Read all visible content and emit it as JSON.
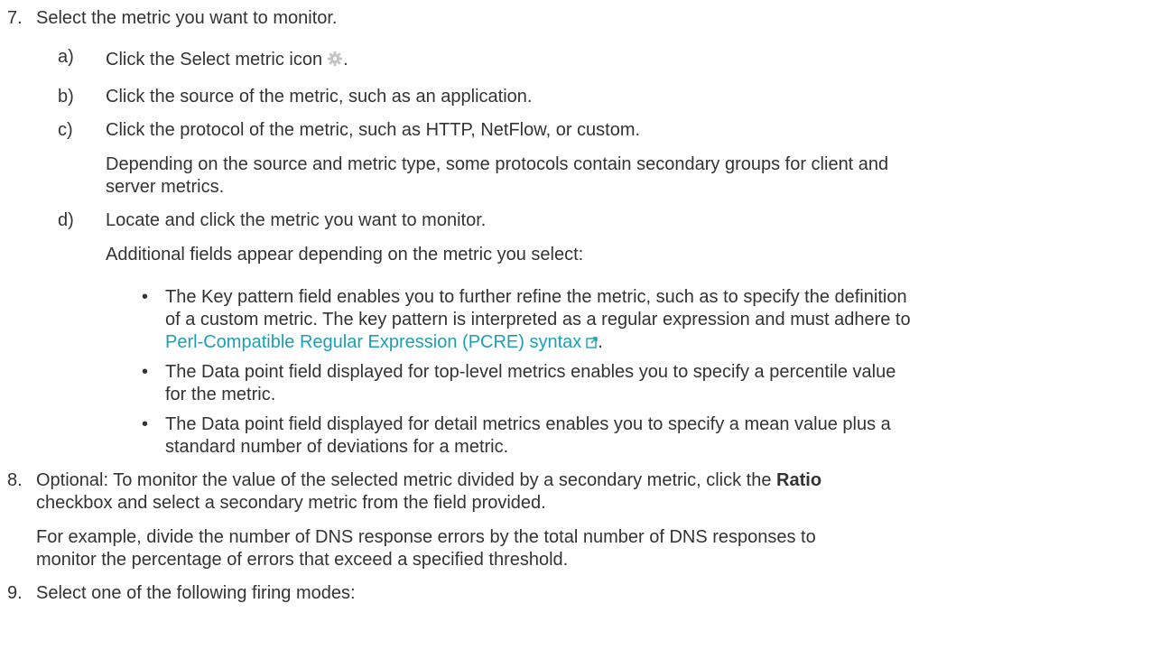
{
  "step7": {
    "number": "7.",
    "text": "Select the metric you want to monitor.",
    "a": {
      "letter": "a)",
      "text": "Click the Select metric icon",
      "icon": "gear-icon",
      "tail": "."
    },
    "b": {
      "letter": "b)",
      "text": "Click the source of the metric, such as an application."
    },
    "c": {
      "letter": "c)",
      "text": "Click the protocol of the metric, such as HTTP, NetFlow, or custom.",
      "note_line1": "Depending on the source and metric type, some protocols contain secondary groups for client and",
      "note_line2": "server metrics."
    },
    "d": {
      "letter": "d)",
      "text": "Locate and click the metric you want to monitor.",
      "note": "Additional fields appear depending on the metric you select:",
      "bullet_char": "•",
      "bullets": [
        {
          "line1": "The Key pattern field enables you to further refine the metric, such as to specify the definition",
          "line2": "of a custom metric. The key pattern is interpreted as a regular expression and must adhere to",
          "link_text": "Perl-Compatible Regular Expression (PCRE) syntax",
          "link_icon": "external-link-icon",
          "tail": "."
        },
        {
          "line1": "The Data point field displayed for top-level metrics enables you to specify a percentile value",
          "line2": "for the metric."
        },
        {
          "line1": "The Data point field displayed for detail metrics enables you to specify a mean value plus a",
          "line2": "standard number of deviations for a metric."
        }
      ]
    }
  },
  "step8": {
    "number": "8.",
    "line1_pre": "Optional: To monitor the value of the selected metric divided by a secondary metric, click the",
    "line1_bold": "Ratio",
    "line2": "checkbox and select a secondary metric from the field provided.",
    "note_line1": "For example, divide the number of DNS response errors by the total number of DNS responses to",
    "note_line2": "monitor the percentage of errors that exceed a specified threshold."
  },
  "step9": {
    "number": "9.",
    "text": "Select one of the following firing modes:"
  },
  "colors": {
    "text": "#333333",
    "link": "#1a9fb4"
  }
}
